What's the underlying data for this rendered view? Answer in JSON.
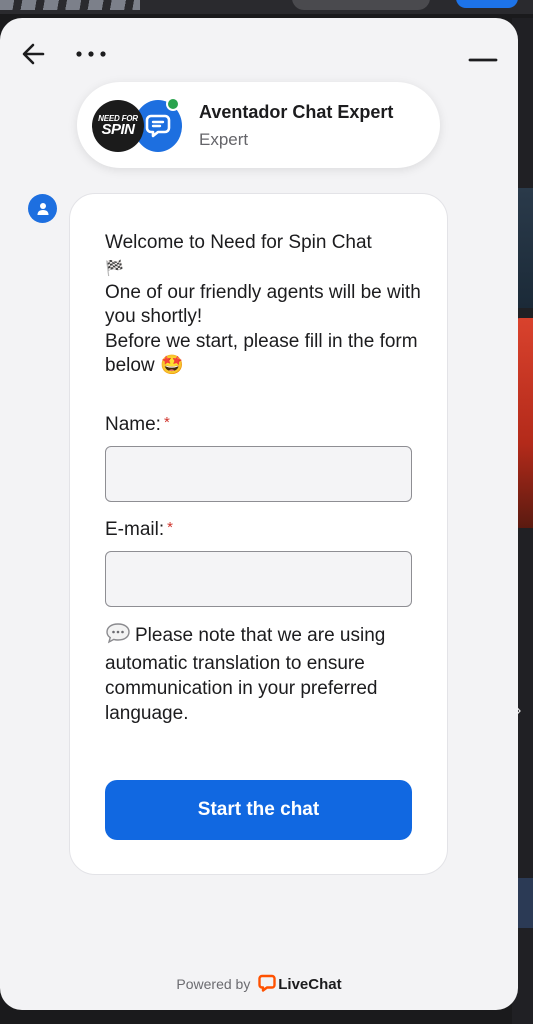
{
  "header": {
    "back_icon": "arrow-left-icon",
    "menu_icon": "more-horizontal-icon",
    "minimize_icon": "minimize-icon"
  },
  "agent": {
    "name": "Aventador Chat Expert",
    "role": "Expert",
    "logo_text_top": "NEED FOR",
    "logo_text_bottom": "SPIN",
    "status_color": "#2aa34d"
  },
  "message": {
    "welcome_line1": "Welcome to Need for Spin Chat",
    "welcome_line2": "One of our friendly agents will be with you shortly!",
    "welcome_line3": "Before we start, please fill in the form below",
    "welcome_emoji": "🤩",
    "flag_emoji": "🏁",
    "name_label": "Name:",
    "email_label": "E-mail:",
    "required_mark": "*",
    "name_value": "",
    "email_value": "",
    "note_text": "Please note that we are using automatic translation to ensure communication in your preferred language.",
    "start_button": "Start the chat"
  },
  "footer": {
    "powered_by": "Powered by",
    "brand": "LiveChat",
    "brand_color": "#ff5100"
  },
  "colors": {
    "accent": "#1168e1",
    "widget_bg": "#f3f3f5"
  }
}
